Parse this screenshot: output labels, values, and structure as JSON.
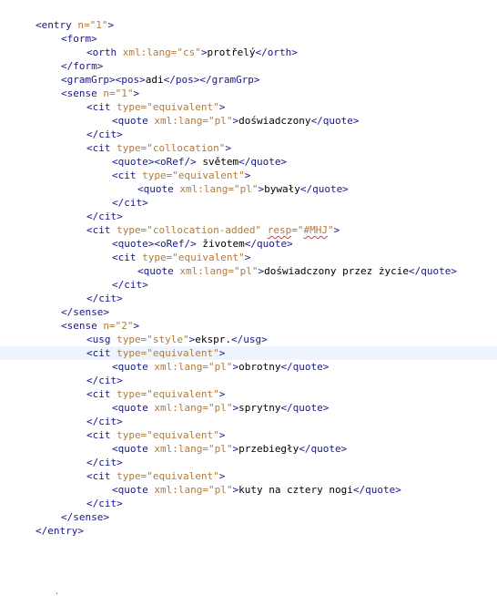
{
  "colors": {
    "tag": "#17178a",
    "attribute": "#b07a3e",
    "text": "#000000",
    "current_line": "#eef4fb",
    "spelling_underline": "#d83a3a"
  },
  "lines": [
    {
      "indent": 0,
      "current": false,
      "tokens": [
        {
          "c": "tag",
          "t": "<entry "
        },
        {
          "c": "attr",
          "t": "n=\"1\""
        },
        {
          "c": "tag",
          "t": ">"
        }
      ]
    },
    {
      "indent": 1,
      "current": false,
      "tokens": [
        {
          "c": "tag",
          "t": "<form>"
        }
      ]
    },
    {
      "indent": 2,
      "current": false,
      "tokens": [
        {
          "c": "tag",
          "t": "<orth "
        },
        {
          "c": "attr",
          "t": "xml:lang=\"cs\""
        },
        {
          "c": "tag",
          "t": ">"
        },
        {
          "c": "txt",
          "t": "protřelý"
        },
        {
          "c": "tag",
          "t": "</orth>"
        }
      ]
    },
    {
      "indent": 1,
      "current": false,
      "tokens": [
        {
          "c": "tag",
          "t": "</form>"
        }
      ]
    },
    {
      "indent": 1,
      "current": false,
      "tokens": [
        {
          "c": "tag",
          "t": "<gramGrp><pos>"
        },
        {
          "c": "txt",
          "t": "adi"
        },
        {
          "c": "tag",
          "t": "</pos></gramGrp>"
        }
      ]
    },
    {
      "indent": 1,
      "current": false,
      "tokens": [
        {
          "c": "tag",
          "t": "<sense "
        },
        {
          "c": "attr",
          "t": "n=\"1\""
        },
        {
          "c": "tag",
          "t": ">"
        }
      ]
    },
    {
      "indent": 2,
      "current": false,
      "tokens": [
        {
          "c": "tag",
          "t": "<cit "
        },
        {
          "c": "attr",
          "t": "type=\"equivalent\""
        },
        {
          "c": "tag",
          "t": ">"
        }
      ]
    },
    {
      "indent": 3,
      "current": false,
      "tokens": [
        {
          "c": "tag",
          "t": "<quote "
        },
        {
          "c": "attr",
          "t": "xml:lang=\"pl\""
        },
        {
          "c": "tag",
          "t": ">"
        },
        {
          "c": "txt",
          "t": "doświadczony"
        },
        {
          "c": "tag",
          "t": "</quote>"
        }
      ]
    },
    {
      "indent": 2,
      "current": false,
      "tokens": [
        {
          "c": "tag",
          "t": "</cit>"
        }
      ]
    },
    {
      "indent": 2,
      "current": false,
      "tokens": [
        {
          "c": "tag",
          "t": "<cit "
        },
        {
          "c": "attr",
          "t": "type=\"collocation\""
        },
        {
          "c": "tag",
          "t": ">"
        }
      ]
    },
    {
      "indent": 3,
      "current": false,
      "tokens": [
        {
          "c": "tag",
          "t": "<quote><oRef/>"
        },
        {
          "c": "txt",
          "t": " světem"
        },
        {
          "c": "tag",
          "t": "</quote>"
        }
      ]
    },
    {
      "indent": 3,
      "current": false,
      "tokens": [
        {
          "c": "tag",
          "t": "<cit "
        },
        {
          "c": "attr",
          "t": "type=\"equivalent\""
        },
        {
          "c": "tag",
          "t": ">"
        }
      ]
    },
    {
      "indent": 4,
      "current": false,
      "tokens": [
        {
          "c": "tag",
          "t": "<quote "
        },
        {
          "c": "attr",
          "t": "xml:lang=\"pl\""
        },
        {
          "c": "tag",
          "t": ">"
        },
        {
          "c": "txt",
          "t": "bywały"
        },
        {
          "c": "tag",
          "t": "</quote>"
        }
      ]
    },
    {
      "indent": 3,
      "current": false,
      "tokens": [
        {
          "c": "tag",
          "t": "</cit>"
        }
      ]
    },
    {
      "indent": 2,
      "current": false,
      "tokens": [
        {
          "c": "tag",
          "t": "</cit>"
        }
      ]
    },
    {
      "indent": 2,
      "current": false,
      "tokens": [
        {
          "c": "tag",
          "t": "<cit "
        },
        {
          "c": "attr",
          "t": "type=\"collocation-added\""
        },
        {
          "c": "tag",
          "t": " "
        },
        {
          "c": "attr",
          "t": "resp",
          "spell": true
        },
        {
          "c": "attr",
          "t": "=\""
        },
        {
          "c": "attr",
          "t": "#MHJ",
          "spell": true
        },
        {
          "c": "attr",
          "t": "\""
        },
        {
          "c": "tag",
          "t": ">"
        }
      ]
    },
    {
      "indent": 3,
      "current": false,
      "tokens": [
        {
          "c": "tag",
          "t": "<quote><oRef/>"
        },
        {
          "c": "txt",
          "t": " životem"
        },
        {
          "c": "tag",
          "t": "</quote>"
        }
      ]
    },
    {
      "indent": 3,
      "current": false,
      "tokens": [
        {
          "c": "tag",
          "t": "<cit "
        },
        {
          "c": "attr",
          "t": "type=\"equivalent\""
        },
        {
          "c": "tag",
          "t": ">"
        }
      ]
    },
    {
      "indent": 4,
      "current": false,
      "tokens": [
        {
          "c": "tag",
          "t": "<quote "
        },
        {
          "c": "attr",
          "t": "xml:lang=\"pl\""
        },
        {
          "c": "tag",
          "t": ">"
        },
        {
          "c": "txt",
          "t": "doświadczony przez życie"
        },
        {
          "c": "tag",
          "t": "</quote>"
        }
      ]
    },
    {
      "indent": 3,
      "current": false,
      "tokens": [
        {
          "c": "tag",
          "t": "</cit>"
        }
      ]
    },
    {
      "indent": 2,
      "current": false,
      "tokens": [
        {
          "c": "tag",
          "t": "</cit>"
        }
      ]
    },
    {
      "indent": 1,
      "current": false,
      "tokens": [
        {
          "c": "tag",
          "t": "</sense>"
        }
      ]
    },
    {
      "indent": 1,
      "current": false,
      "tokens": [
        {
          "c": "tag",
          "t": "<sense "
        },
        {
          "c": "attr",
          "t": "n=\"2\""
        },
        {
          "c": "tag",
          "t": ">"
        }
      ]
    },
    {
      "indent": 2,
      "current": false,
      "tokens": [
        {
          "c": "tag",
          "t": "<usg "
        },
        {
          "c": "attr",
          "t": "type=\"style\""
        },
        {
          "c": "tag",
          "t": ">"
        },
        {
          "c": "txt",
          "t": "ekspr."
        },
        {
          "c": "tag",
          "t": "</usg>"
        }
      ]
    },
    {
      "indent": 2,
      "current": true,
      "tokens": [
        {
          "c": "tag",
          "t": "<cit "
        },
        {
          "c": "attr",
          "t": "type=\"equivalent\""
        },
        {
          "c": "tag",
          "t": ">"
        }
      ]
    },
    {
      "indent": 3,
      "current": false,
      "tokens": [
        {
          "c": "tag",
          "t": "<quote "
        },
        {
          "c": "attr",
          "t": "xml:lang=\"pl\""
        },
        {
          "c": "tag",
          "t": ">"
        },
        {
          "c": "txt",
          "t": "obrotny"
        },
        {
          "c": "tag",
          "t": "</quote>"
        }
      ]
    },
    {
      "indent": 2,
      "current": false,
      "tokens": [
        {
          "c": "tag",
          "t": "</cit>"
        }
      ]
    },
    {
      "indent": 2,
      "current": false,
      "tokens": [
        {
          "c": "tag",
          "t": "<cit "
        },
        {
          "c": "attr",
          "t": "type=\"equivalent\""
        },
        {
          "c": "tag",
          "t": ">"
        }
      ]
    },
    {
      "indent": 3,
      "current": false,
      "tokens": [
        {
          "c": "tag",
          "t": "<quote "
        },
        {
          "c": "attr",
          "t": "xml:lang=\"pl\""
        },
        {
          "c": "tag",
          "t": ">"
        },
        {
          "c": "txt",
          "t": "sprytny"
        },
        {
          "c": "tag",
          "t": "</quote>"
        }
      ]
    },
    {
      "indent": 2,
      "current": false,
      "tokens": [
        {
          "c": "tag",
          "t": "</cit>"
        }
      ]
    },
    {
      "indent": 2,
      "current": false,
      "tokens": [
        {
          "c": "tag",
          "t": "<cit "
        },
        {
          "c": "attr",
          "t": "type=\"equivalent\""
        },
        {
          "c": "tag",
          "t": ">"
        }
      ]
    },
    {
      "indent": 3,
      "current": false,
      "tokens": [
        {
          "c": "tag",
          "t": "<quote "
        },
        {
          "c": "attr",
          "t": "xml:lang=\"pl\""
        },
        {
          "c": "tag",
          "t": ">"
        },
        {
          "c": "txt",
          "t": "przebiegły"
        },
        {
          "c": "tag",
          "t": "</quote>"
        }
      ]
    },
    {
      "indent": 2,
      "current": false,
      "tokens": [
        {
          "c": "tag",
          "t": "</cit>"
        }
      ]
    },
    {
      "indent": 2,
      "current": false,
      "tokens": [
        {
          "c": "tag",
          "t": "<cit "
        },
        {
          "c": "attr",
          "t": "type=\"equivalent\""
        },
        {
          "c": "tag",
          "t": ">"
        }
      ]
    },
    {
      "indent": 3,
      "current": false,
      "tokens": [
        {
          "c": "tag",
          "t": "<quote "
        },
        {
          "c": "attr",
          "t": "xml:lang=\"pl\""
        },
        {
          "c": "tag",
          "t": ">"
        },
        {
          "c": "txt",
          "t": "kuty na cztery nogi"
        },
        {
          "c": "tag",
          "t": "</quote>"
        }
      ]
    },
    {
      "indent": 2,
      "current": false,
      "tokens": [
        {
          "c": "tag",
          "t": "</cit>"
        }
      ]
    },
    {
      "indent": 1,
      "current": false,
      "tokens": [
        {
          "c": "tag",
          "t": "</sense>"
        }
      ]
    },
    {
      "indent": 0,
      "current": false,
      "tokens": [
        {
          "c": "tag",
          "t": "</entry>"
        }
      ]
    }
  ]
}
